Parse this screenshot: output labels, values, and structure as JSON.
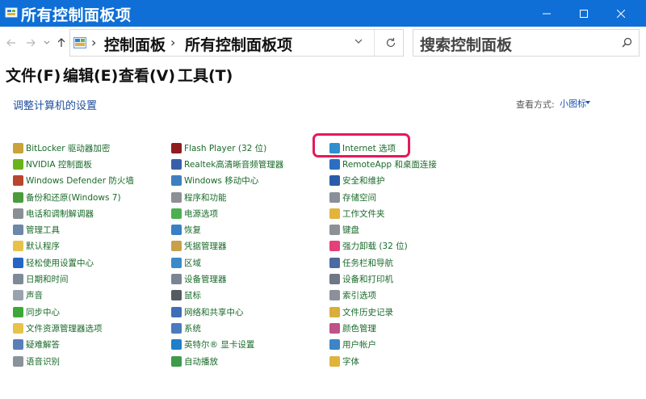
{
  "window": {
    "title": "所有控制面板项"
  },
  "address": {
    "crumbs": [
      "控制面板",
      "所有控制面板项"
    ]
  },
  "search": {
    "placeholder": "搜索控制面板"
  },
  "menu": [
    "文件(F)",
    "编辑(E)",
    "查看(V)",
    "工具(T)"
  ],
  "page": {
    "title": "调整计算机的设置",
    "view_by_label": "查看方式:",
    "view_by_value": "小图标"
  },
  "columns": [
    [
      {
        "label": "BitLocker 驱动器加密",
        "icon": "bitlocker-icon",
        "color": "#c9a33a"
      },
      {
        "label": "NVIDIA 控制面板",
        "icon": "nvidia-icon",
        "color": "#6bb31a"
      },
      {
        "label": "Windows Defender 防火墙",
        "icon": "firewall-icon",
        "color": "#b8462e"
      },
      {
        "label": "备份和还原(Windows 7)",
        "icon": "backup-icon",
        "color": "#4b9a3c"
      },
      {
        "label": "电话和调制解调器",
        "icon": "phone-modem-icon",
        "color": "#8a8f95"
      },
      {
        "label": "管理工具",
        "icon": "admin-tools-icon",
        "color": "#6c87a8"
      },
      {
        "label": "默认程序",
        "icon": "default-programs-icon",
        "color": "#e7c24a"
      },
      {
        "label": "轻松使用设置中心",
        "icon": "ease-of-access-icon",
        "color": "#2566c4"
      },
      {
        "label": "日期和时间",
        "icon": "date-time-icon",
        "color": "#7e8a99"
      },
      {
        "label": "声音",
        "icon": "sound-icon",
        "color": "#9aa3ad"
      },
      {
        "label": "同步中心",
        "icon": "sync-center-icon",
        "color": "#3da83a"
      },
      {
        "label": "文件资源管理器选项",
        "icon": "explorer-options-icon",
        "color": "#e8c34a"
      },
      {
        "label": "疑难解答",
        "icon": "troubleshooting-icon",
        "color": "#5a7fb8"
      },
      {
        "label": "语音识别",
        "icon": "speech-recognition-icon",
        "color": "#8a929b"
      }
    ],
    [
      {
        "label": "Flash Player (32 位)",
        "icon": "flash-player-icon",
        "color": "#8f1d1d"
      },
      {
        "label": "Realtek高清晰音频管理器",
        "icon": "realtek-audio-icon",
        "color": "#3a5fa8"
      },
      {
        "label": "Windows 移动中心",
        "icon": "mobility-center-icon",
        "color": "#3e7fc0"
      },
      {
        "label": "程序和功能",
        "icon": "programs-features-icon",
        "color": "#8c8f94"
      },
      {
        "label": "电源选项",
        "icon": "power-options-icon",
        "color": "#4caf50"
      },
      {
        "label": "恢复",
        "icon": "recovery-icon",
        "color": "#3a7fc3"
      },
      {
        "label": "凭据管理器",
        "icon": "credential-manager-icon",
        "color": "#c9a04a"
      },
      {
        "label": "区域",
        "icon": "region-icon",
        "color": "#3c89c9"
      },
      {
        "label": "设备管理器",
        "icon": "device-manager-icon",
        "color": "#7a8594"
      },
      {
        "label": "鼠标",
        "icon": "mouse-icon",
        "color": "#555b61"
      },
      {
        "label": "网络和共享中心",
        "icon": "network-sharing-icon",
        "color": "#3e6fb6"
      },
      {
        "label": "系统",
        "icon": "system-icon",
        "color": "#4a7bbf"
      },
      {
        "label": "英特尔® 显卡设置",
        "icon": "intel-graphics-icon",
        "color": "#1f7fc9"
      },
      {
        "label": "自动播放",
        "icon": "autoplay-icon",
        "color": "#3f9a4a"
      }
    ],
    [
      {
        "label": "Internet 选项",
        "icon": "internet-options-icon",
        "color": "#2f8fd0"
      },
      {
        "label": "RemoteApp 和桌面连接",
        "icon": "remoteapp-icon",
        "color": "#2b6fc1"
      },
      {
        "label": "安全和维护",
        "icon": "security-maintenance-icon",
        "color": "#2a5ba8"
      },
      {
        "label": "存储空间",
        "icon": "storage-spaces-icon",
        "color": "#8a9099"
      },
      {
        "label": "工作文件夹",
        "icon": "work-folders-icon",
        "color": "#e3b43c"
      },
      {
        "label": "键盘",
        "icon": "keyboard-icon",
        "color": "#8c9197"
      },
      {
        "label": "强力卸载 (32 位)",
        "icon": "uninstaller-icon",
        "color": "#e4407a"
      },
      {
        "label": "任务栏和导航",
        "icon": "taskbar-icon",
        "color": "#4a6aa0"
      },
      {
        "label": "设备和打印机",
        "icon": "devices-printers-icon",
        "color": "#6f7884"
      },
      {
        "label": "索引选项",
        "icon": "indexing-options-icon",
        "color": "#8c9199"
      },
      {
        "label": "文件历史记录",
        "icon": "file-history-icon",
        "color": "#d9ae3a"
      },
      {
        "label": "颜色管理",
        "icon": "color-management-icon",
        "color": "#c0518a"
      },
      {
        "label": "用户帐户",
        "icon": "user-accounts-icon",
        "color": "#3b86c8"
      },
      {
        "label": "字体",
        "icon": "fonts-icon",
        "color": "#e0b33c"
      }
    ]
  ]
}
